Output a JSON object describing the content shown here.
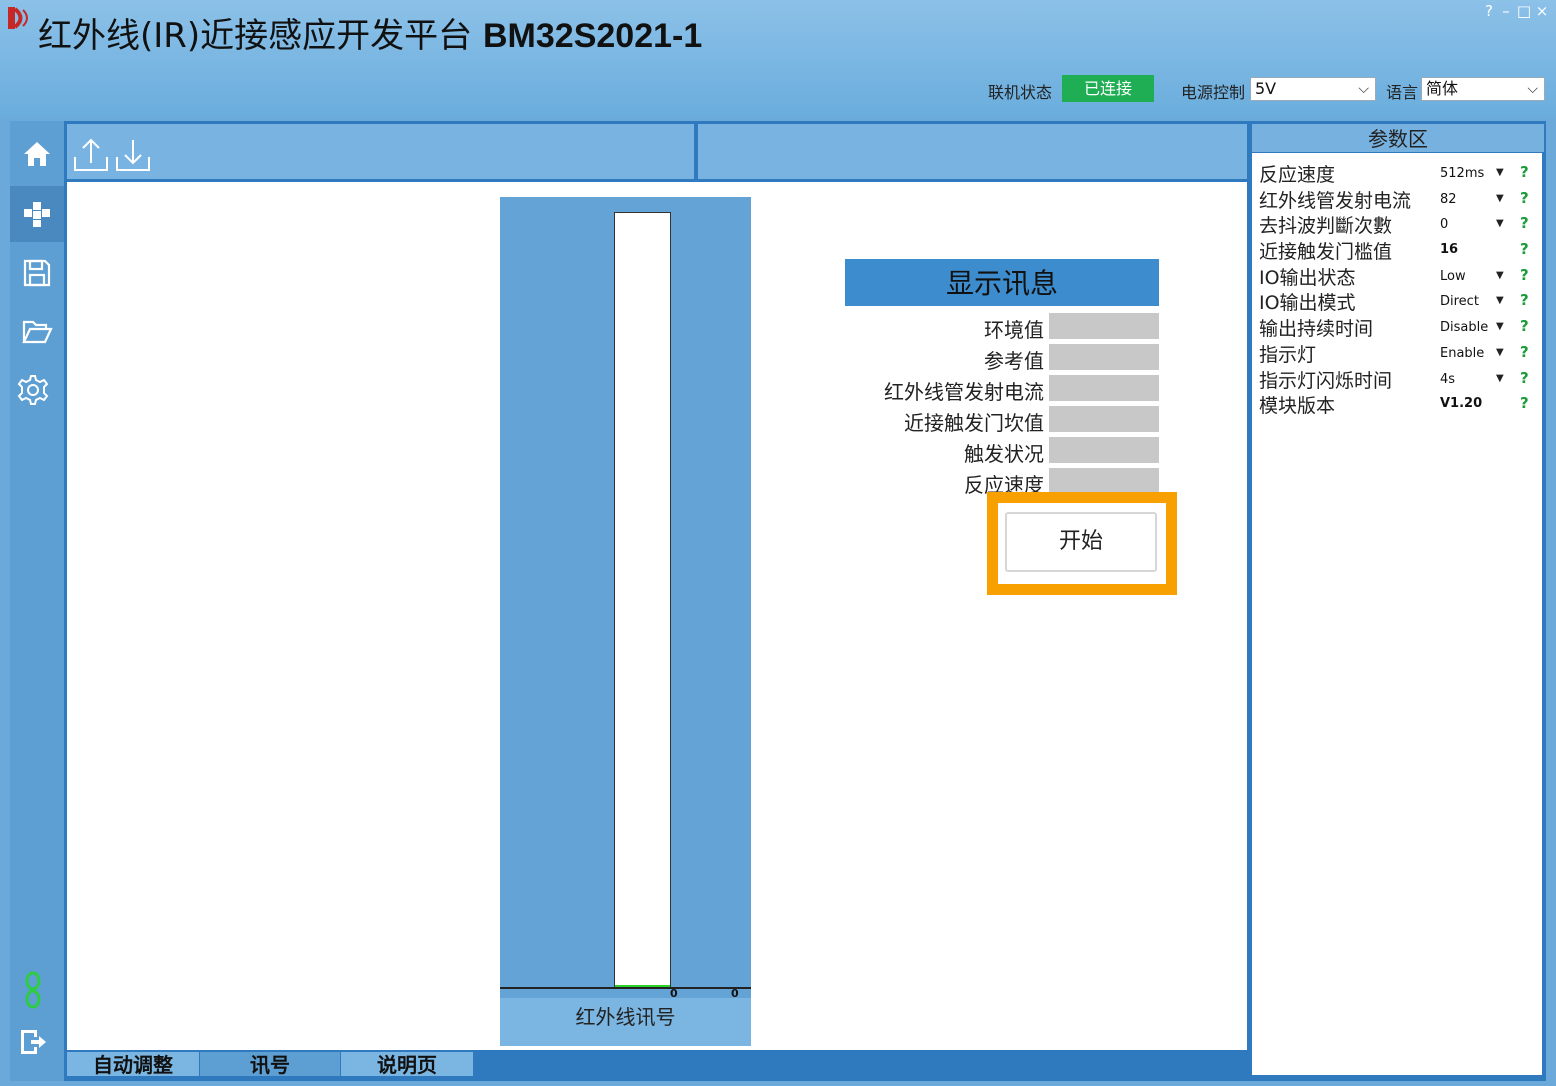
{
  "title": {
    "prefix": "红外线(IR)近接感应开发平台",
    "model": "BM32S2021-1"
  },
  "window_controls": {
    "help": "?",
    "minimize": "–",
    "maximize": "□",
    "close": "×"
  },
  "header": {
    "status_label": "联机状态",
    "status_value": "已连接",
    "status_color": "#1fae54",
    "power_label": "电源控制",
    "power_value": "5V",
    "language_label": "语言",
    "language_value": "简体"
  },
  "nav": [
    "home-icon",
    "modules-icon",
    "save-icon",
    "folder-open-icon",
    "gear-icon",
    "link-icon",
    "exit-icon"
  ],
  "toolbar": [
    "upload-icon",
    "download-icon"
  ],
  "gauge": {
    "value": 0,
    "level_fraction": 0,
    "tick_left": "0",
    "tick_right": "0",
    "label": "红外线讯号"
  },
  "display": {
    "title": "显示讯息",
    "rows": [
      "环境值",
      "参考值",
      "红外线管发射电流",
      "近接触发门坎值",
      "触发状况",
      "反应速度"
    ],
    "start_button": "开始"
  },
  "tabs": [
    "自动调整",
    "讯号",
    "说明页"
  ],
  "params": {
    "title": "参数区",
    "items": [
      {
        "label": "反应速度",
        "value": "512ms",
        "dropdown": true
      },
      {
        "label": "红外线管发射电流",
        "value": "82",
        "dropdown": true
      },
      {
        "label": "去抖波判斷次數",
        "value": "0",
        "dropdown": true
      },
      {
        "label": "近接触发门槛值",
        "value": "16",
        "dropdown": false
      },
      {
        "label": "IO输出状态",
        "value": "Low",
        "dropdown": true
      },
      {
        "label": "IO输出模式",
        "value": "Direct",
        "dropdown": true
      },
      {
        "label": "输出持续时间",
        "value": "Disable",
        "dropdown": true
      },
      {
        "label": "指示灯",
        "value": "Enable",
        "dropdown": true
      },
      {
        "label": "指示灯闪烁时间",
        "value": "4s",
        "dropdown": true
      },
      {
        "label": "模块版本",
        "value": "V1.20",
        "dropdown": false
      }
    ],
    "help": "?"
  }
}
